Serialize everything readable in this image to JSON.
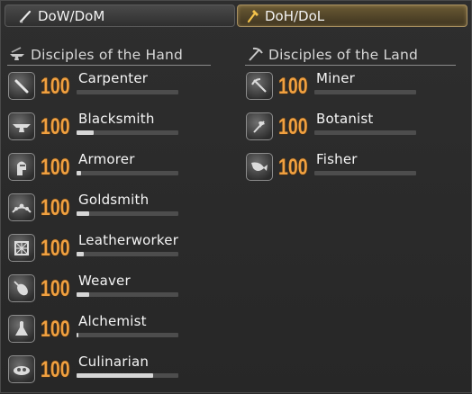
{
  "tabs": [
    {
      "label": "DoW/DoM",
      "active": false,
      "icon": "sword-icon"
    },
    {
      "label": "DoH/DoL",
      "active": true,
      "icon": "hammer-icon"
    }
  ],
  "hand": {
    "title": "Disciples of the Hand",
    "jobs": [
      {
        "level": "100",
        "name": "Carpenter",
        "exp_fraction": 0.0,
        "icon": "saw-icon"
      },
      {
        "level": "100",
        "name": "Blacksmith",
        "exp_fraction": 0.17,
        "icon": "anvil-icon"
      },
      {
        "level": "100",
        "name": "Armorer",
        "exp_fraction": 0.04,
        "icon": "helmet-icon"
      },
      {
        "level": "100",
        "name": "Goldsmith",
        "exp_fraction": 0.12,
        "icon": "tiara-icon"
      },
      {
        "level": "100",
        "name": "Leatherworker",
        "exp_fraction": 0.07,
        "icon": "leather-icon"
      },
      {
        "level": "100",
        "name": "Weaver",
        "exp_fraction": 0.12,
        "icon": "needle-icon"
      },
      {
        "level": "100",
        "name": "Alchemist",
        "exp_fraction": 0.02,
        "icon": "flask-icon"
      },
      {
        "level": "100",
        "name": "Culinarian",
        "exp_fraction": 0.75,
        "icon": "cooking-icon"
      }
    ]
  },
  "land": {
    "title": "Disciples of the Land",
    "jobs": [
      {
        "level": "100",
        "name": "Miner",
        "exp_fraction": 0.0,
        "icon": "pickaxe-icon"
      },
      {
        "level": "100",
        "name": "Botanist",
        "exp_fraction": 0.0,
        "icon": "hatchet-icon"
      },
      {
        "level": "100",
        "name": "Fisher",
        "exp_fraction": 0.0,
        "icon": "fish-icon"
      }
    ]
  },
  "colors": {
    "level": "#f0a040",
    "tab_active": "#6b5a34",
    "bar_fill": "#d6d6d6"
  }
}
